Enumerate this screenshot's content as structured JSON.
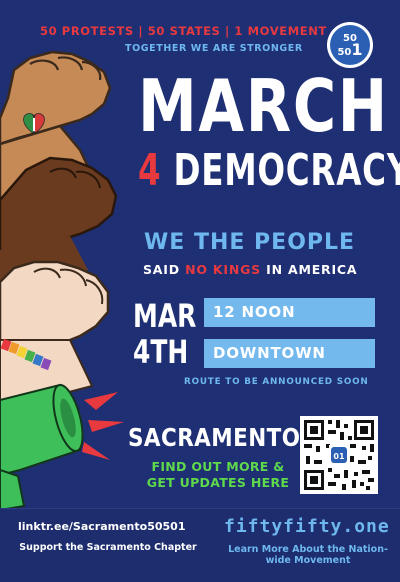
{
  "header": {
    "tagline_top": "50 PROTESTS | 50 STATES | 1 MOVEMENT",
    "tagline_sub": "TOGETHER WE ARE STRONGER",
    "badge_line1": "50",
    "badge_line2": "50",
    "badge_digit": "1"
  },
  "title": {
    "line1": "MARCH",
    "four": "4",
    "line2": "DEMOCRACY"
  },
  "slogan": {
    "headline": "WE THE PEOPLE",
    "sub_before": "SAID ",
    "sub_highlight": "NO KINGS",
    "sub_after": " IN AMERICA"
  },
  "event": {
    "month": "MAR",
    "day": "4TH",
    "time": "12 NOON",
    "place": "DOWNTOWN",
    "route_note": "ROUTE TO BE ANNOUNCED SOON"
  },
  "location": {
    "city": "SACRAMENTO",
    "cta": "FIND OUT MORE & GET UPDATES HERE"
  },
  "footer": {
    "link": "linktr.ee/Sacramento50501",
    "support": "Support the Sacramento Chapter",
    "site": "fiftyfifty.one",
    "learn": "Learn More About the Nation-wide Movement"
  },
  "colors": {
    "background": "#1f2f74",
    "red": "#e8393f",
    "light_blue": "#6fb8ef",
    "green": "#5ed94c",
    "white": "#ffffff"
  },
  "icons": [
    "raised-fist-icon",
    "mexico-heart-flag-icon",
    "rainbow-bracelet-icon",
    "megaphone-icon",
    "qr-code-icon"
  ]
}
